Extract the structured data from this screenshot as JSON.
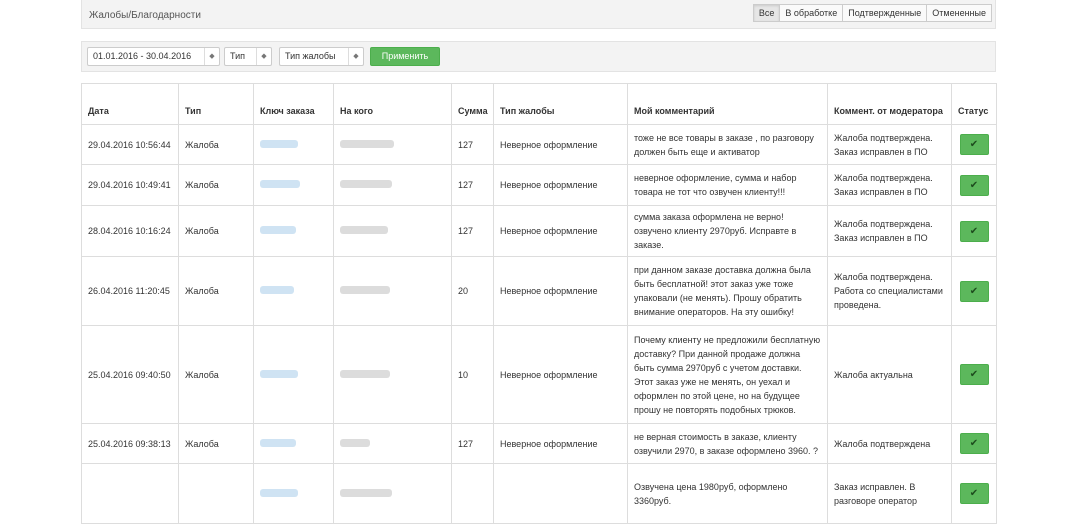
{
  "header": {
    "title": "Жалобы/Благодарности",
    "filters": [
      "Все",
      "В обработке",
      "Подтвержденные",
      "Отмененные"
    ],
    "active_filter": "Все"
  },
  "filterbar": {
    "date_range": "01.01.2016 - 30.04.2016",
    "type": "Тип",
    "complaint_type": "Тип жалобы",
    "apply_label": "Применить"
  },
  "table": {
    "columns": [
      "Дата",
      "Тип",
      "Ключ заказа",
      "На кого",
      "Сумма",
      "Тип жалобы",
      "Мой комментарий",
      "Коммент. от модератора",
      "Статус"
    ],
    "rows": [
      {
        "date": "29.04.2016 10:56:44",
        "type": "Жалоба",
        "sum": "127",
        "ctype": "Неверное оформление",
        "comment": "тоже не все товары в заказе , по разговору должен быть еще и активатор",
        "moderator": "Жалоба подтверждена. Заказ исправлен в ПО"
      },
      {
        "date": "29.04.2016 10:49:41",
        "type": "Жалоба",
        "sum": "127",
        "ctype": "Неверное оформление",
        "comment": "неверное оформление, сумма и набор товара не тот что озвучен клиенту!!!",
        "moderator": "Жалоба подтверждена. Заказ исправлен в ПО"
      },
      {
        "date": "28.04.2016 10:16:24",
        "type": "Жалоба",
        "sum": "127",
        "ctype": "Неверное оформление",
        "comment": "сумма заказа оформлена не верно! озвучено клиенту 2970руб. Исправте в заказе.",
        "moderator": "Жалоба подтверждена. Заказ исправлен в ПО"
      },
      {
        "date": "26.04.2016 11:20:45",
        "type": "Жалоба",
        "sum": "20",
        "ctype": "Неверное оформление",
        "comment": "при данном заказе доставка должна была быть бесплатной! этот заказ уже тоже упаковали (не менять). Прошу обратить внимание операторов. На эту ошибку!",
        "moderator": "Жалоба подтверждена. Работа со специалистами проведена."
      },
      {
        "date": "25.04.2016 09:40:50",
        "type": "Жалоба",
        "sum": "10",
        "ctype": "Неверное оформление",
        "comment": "Почему клиенту не предложили бесплатную доставку? При данной продаже должна быть сумма 2970руб с учетом доставки. Этот заказ уже не менять, он уехал и оформлен по этой цене, но на будущее прошу не повторять подобных трюков.",
        "moderator": "Жалоба актуальна"
      },
      {
        "date": "25.04.2016 09:38:13",
        "type": "Жалоба",
        "sum": "127",
        "ctype": "Неверное оформление",
        "comment": "не верная стоимость в заказе, клиенту озвучили 2970, в заказе оформлено 3960. ?",
        "moderator": "Жалоба подтверждена"
      },
      {
        "date": "",
        "type": "",
        "sum": "",
        "ctype": "",
        "comment": "Озвучена цена 1980руб, оформлено 3360руб.",
        "moderator": "Заказ исправлен. В разговоре оператор"
      }
    ]
  },
  "icons": {
    "status": "check-icon",
    "select_arrow": "updown-arrow-icon"
  },
  "colors": {
    "accent": "#5cb85c",
    "link_blur": "#cfe3f3",
    "bg_bar": "#f3f3f3"
  }
}
